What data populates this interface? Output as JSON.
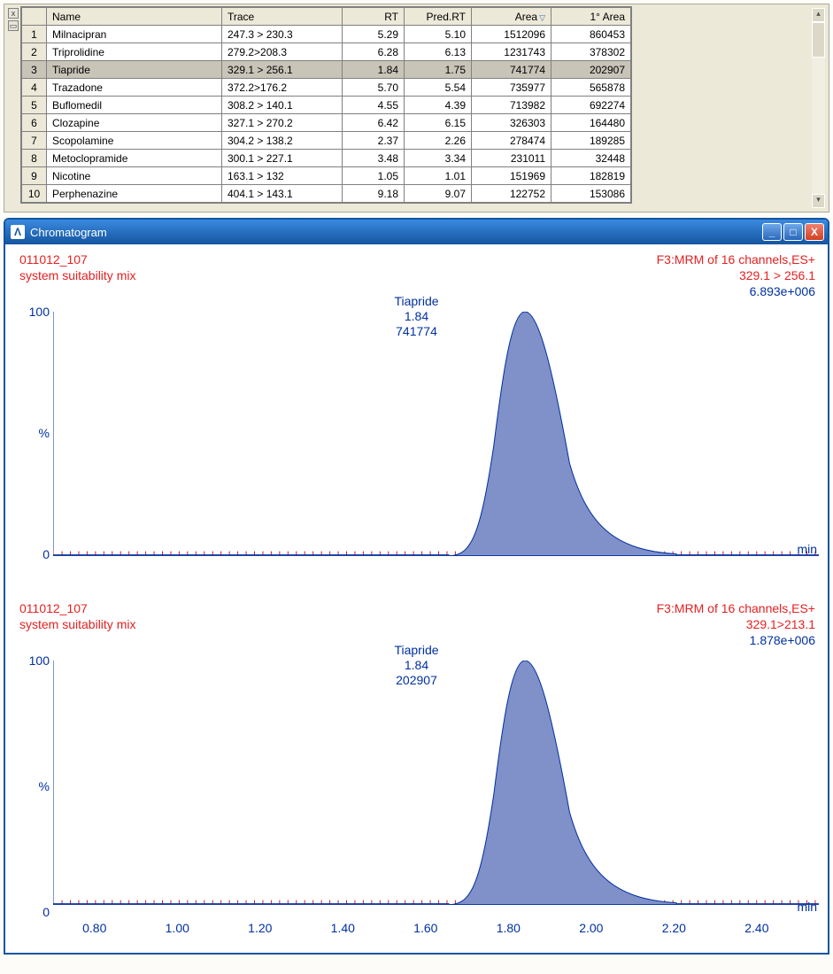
{
  "table": {
    "columns": [
      "",
      "Name",
      "Trace",
      "RT",
      "Pred.RT",
      "Area",
      "1° Area"
    ],
    "sorted_column": "Area",
    "rows": [
      {
        "n": "1",
        "name": "Milnacipran",
        "trace": "247.3 > 230.3",
        "rt": "5.29",
        "predrt": "5.10",
        "area": "1512096",
        "area2": "860453"
      },
      {
        "n": "2",
        "name": "Triprolidine",
        "trace": "279.2>208.3",
        "rt": "6.28",
        "predrt": "6.13",
        "area": "1231743",
        "area2": "378302"
      },
      {
        "n": "3",
        "name": "Tiapride",
        "trace": "329.1 > 256.1",
        "rt": "1.84",
        "predrt": "1.75",
        "area": "741774",
        "area2": "202907",
        "selected": true
      },
      {
        "n": "4",
        "name": "Trazadone",
        "trace": "372.2>176.2",
        "rt": "5.70",
        "predrt": "5.54",
        "area": "735977",
        "area2": "565878"
      },
      {
        "n": "5",
        "name": "Buflomedil",
        "trace": "308.2 > 140.1",
        "rt": "4.55",
        "predrt": "4.39",
        "area": "713982",
        "area2": "692274"
      },
      {
        "n": "6",
        "name": "Clozapine",
        "trace": "327.1 > 270.2",
        "rt": "6.42",
        "predrt": "6.15",
        "area": "326303",
        "area2": "164480"
      },
      {
        "n": "7",
        "name": "Scopolamine",
        "trace": "304.2 > 138.2",
        "rt": "2.37",
        "predrt": "2.26",
        "area": "278474",
        "area2": "189285"
      },
      {
        "n": "8",
        "name": "Metoclopramide",
        "trace": "300.1 > 227.1",
        "rt": "3.48",
        "predrt": "3.34",
        "area": "231011",
        "area2": "32448"
      },
      {
        "n": "9",
        "name": "Nicotine",
        "trace": "163.1 > 132",
        "rt": "1.05",
        "predrt": "1.01",
        "area": "151969",
        "area2": "182819"
      },
      {
        "n": "10",
        "name": "Perphenazine",
        "trace": "404.1 > 143.1",
        "rt": "9.18",
        "predrt": "9.07",
        "area": "122752",
        "area2": "153086"
      }
    ]
  },
  "chrom_window": {
    "title": "Chromatogram"
  },
  "plots": [
    {
      "sample_id": "011012_107",
      "sample_desc": "system suitability mix",
      "channel": "F3:MRM of 16 channels,ES+",
      "transition": "329.1 > 256.1",
      "intensity": "6.893e+006",
      "peak_name": "Tiapride",
      "peak_rt": "1.84",
      "peak_area": "741774",
      "x_unit": "min",
      "y_ticks": [
        "100",
        "%",
        "0"
      ]
    },
    {
      "sample_id": "011012_107",
      "sample_desc": "system suitability mix",
      "channel": "F3:MRM of 16 channels,ES+",
      "transition": "329.1>213.1",
      "intensity": "1.878e+006",
      "peak_name": "Tiapride",
      "peak_rt": "1.84",
      "peak_area": "202907",
      "x_unit": "min",
      "y_ticks": [
        "100",
        "%",
        "0"
      ],
      "x_ticks": [
        "0.80",
        "1.00",
        "1.20",
        "1.40",
        "1.60",
        "1.80",
        "2.00",
        "2.20",
        "2.40"
      ]
    }
  ],
  "chart_data": [
    {
      "type": "line",
      "title": "Tiapride 329.1 > 256.1",
      "xlabel": "min",
      "ylabel": "%",
      "ylim": [
        0,
        100
      ],
      "xlim": [
        0.7,
        2.55
      ],
      "peak": {
        "name": "Tiapride",
        "rt": 1.84,
        "area": 741774,
        "apex_pct": 100
      },
      "series": [
        {
          "name": "Tiapride",
          "x_apex": 1.84,
          "baseline": [
            1.62,
            2.2
          ]
        }
      ]
    },
    {
      "type": "line",
      "title": "Tiapride 329.1>213.1",
      "xlabel": "min",
      "ylabel": "%",
      "ylim": [
        0,
        100
      ],
      "xlim": [
        0.7,
        2.55
      ],
      "peak": {
        "name": "Tiapride",
        "rt": 1.84,
        "area": 202907,
        "apex_pct": 100
      },
      "series": [
        {
          "name": "Tiapride",
          "x_apex": 1.84,
          "baseline": [
            1.62,
            2.2
          ]
        }
      ]
    }
  ]
}
